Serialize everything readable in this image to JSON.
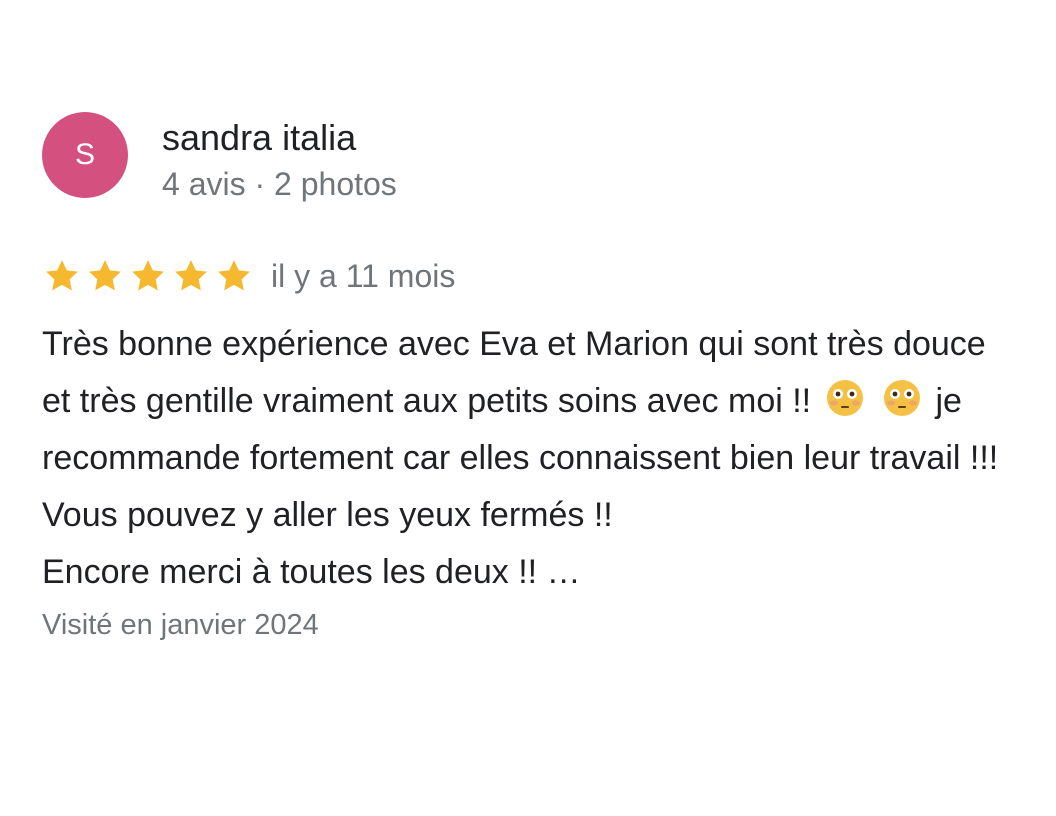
{
  "author": {
    "initial": "S",
    "name": "sandra italia",
    "meta": "4 avis · 2 photos",
    "avatar_color": "#d4517f"
  },
  "rating": {
    "stars": 5,
    "max": 5,
    "star_color": "#f5b82e",
    "time_ago": "il y a 11 mois"
  },
  "review": {
    "part1": "Très bonne expérience avec Eva et Marion qui sont très douce et très gentille vraiment aux petits soins avec moi !!",
    "emoji_1": "flushed-face-emoji",
    "emoji_2": "flushed-face-emoji",
    "part2": " je recommande fortement car elles connaissent bien leur travail !!! Vous pouvez y aller les yeux fermés !!",
    "line_last": "Encore merci à toutes les deux !! …"
  },
  "visited": "Visité en janvier 2024"
}
